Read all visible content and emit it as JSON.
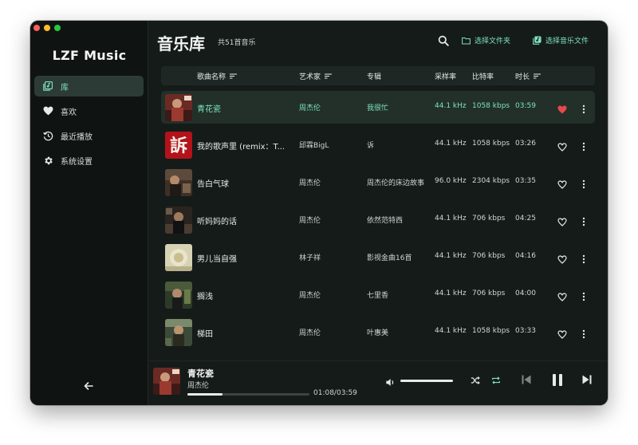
{
  "app": {
    "title": "LZF Music",
    "window_buttons": [
      "#ff5f57",
      "#febc2e",
      "#28c840"
    ]
  },
  "colors": {
    "accent": "#7fe3c0",
    "background": "#151b19",
    "sidebar": "#0f1412",
    "heart": "#e5484d"
  },
  "sidebar": {
    "items": [
      {
        "label": "库",
        "icon": "library-icon",
        "active": true
      },
      {
        "label": "喜欢",
        "icon": "heart-icon"
      },
      {
        "label": "最近播放",
        "icon": "history-icon"
      },
      {
        "label": "系统设置",
        "icon": "gear-icon"
      }
    ],
    "back_icon": "arrow-left-icon"
  },
  "header": {
    "title": "音乐库",
    "count": "共51首音乐",
    "search_icon": "search-icon",
    "select_folder": "选择文件夹",
    "select_files": "选择音乐文件"
  },
  "table": {
    "columns": {
      "title": "歌曲名称",
      "artist": "艺术家",
      "album": "专辑",
      "sample_rate": "采样率",
      "bitrate": "比特率",
      "duration": "时长"
    },
    "rows": [
      {
        "title": "青花瓷",
        "artist": "周杰伦",
        "album": "我很忙",
        "sample_rate": "44.1 kHz",
        "bitrate": "1058 kbps",
        "duration": "03:59",
        "liked": true,
        "active": true
      },
      {
        "title": "我的歌声里 (remix：T...",
        "artist": "邱霖BigL",
        "album": "诉",
        "sample_rate": "44.1 kHz",
        "bitrate": "1058 kbps",
        "duration": "03:26",
        "liked": false,
        "cover_text": "訴"
      },
      {
        "title": "告白气球",
        "artist": "周杰伦",
        "album": "周杰伦的床边故事",
        "sample_rate": "96.0 kHz",
        "bitrate": "2304 kbps",
        "duration": "03:35",
        "liked": false
      },
      {
        "title": "听妈妈的话",
        "artist": "周杰伦",
        "album": "依然范特西",
        "sample_rate": "44.1 kHz",
        "bitrate": "706 kbps",
        "duration": "04:25",
        "liked": false
      },
      {
        "title": "男儿当自强",
        "artist": "林子祥",
        "album": "影视金曲16首",
        "sample_rate": "44.1 kHz",
        "bitrate": "706 kbps",
        "duration": "04:16",
        "liked": false
      },
      {
        "title": "搁浅",
        "artist": "周杰伦",
        "album": "七里香",
        "sample_rate": "44.1 kHz",
        "bitrate": "706 kbps",
        "duration": "04:00",
        "liked": false
      },
      {
        "title": "梯田",
        "artist": "周杰伦",
        "album": "叶惠美",
        "sample_rate": "44.1 kHz",
        "bitrate": "1058 kbps",
        "duration": "03:33",
        "liked": false
      }
    ]
  },
  "player": {
    "title": "青花瓷",
    "artist": "周杰伦",
    "time": "01:08/03:59",
    "progress": 0.285,
    "volume": 1.0
  }
}
